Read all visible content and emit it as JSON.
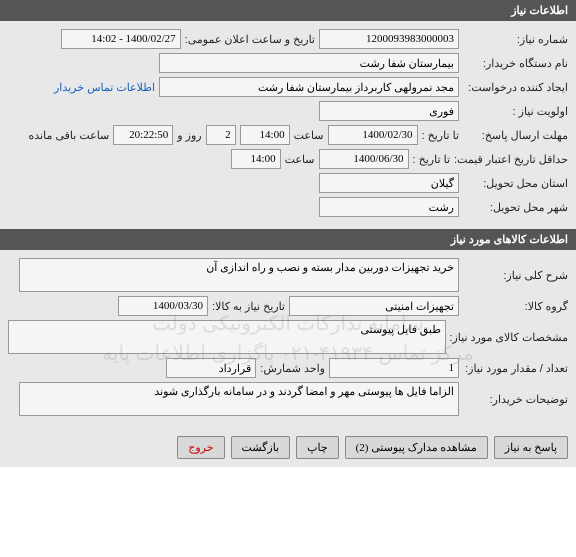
{
  "section1": {
    "title": "اطلاعات نیاز",
    "req_no_label": "شماره نیاز:",
    "req_no": "1200093983000003",
    "announce_label": "تاریخ و ساعت اعلان عمومی:",
    "announce": "1400/02/27 - 14:02",
    "buyer_label": "نام دستگاه خریدار:",
    "buyer": "بیمارستان شفا رشت",
    "creator_label": "ایجاد کننده درخواست:",
    "creator": "مجد نمرولهی کاربرداز بیمارستان شفا رشت",
    "contact_link": "اطلاعات تماس خریدار",
    "priority_label": "اولویت نیاز :",
    "priority": "فوری",
    "deadline_label": "مهلت ارسال پاسخ:",
    "deadline_to_label": "تا تاریخ :",
    "deadline_date": "1400/02/30",
    "time_label": "ساعت",
    "deadline_time": "14:00",
    "days": "2",
    "days_label": "روز و",
    "remain": "20:22:50",
    "remain_label": "ساعت باقی مانده",
    "min_credit_label": "حداقل تاریخ اعتبار قیمت:",
    "min_credit_to_label": "تا تاریخ :",
    "min_credit_date": "1400/06/30",
    "min_credit_time": "14:00",
    "province_label": "استان محل تحویل:",
    "province": "گیلان",
    "city_label": "شهر محل تحویل:",
    "city": "رشت"
  },
  "section2": {
    "title": "اطلاعات کالاهای مورد نیاز",
    "desc_label": "شرح کلی نیاز:",
    "desc": "خرید تجهیزات دوربین مدار بسته و نصب و راه اندازی آن",
    "group_label": "گروه کالا:",
    "group": "تجهیزات امنیتی",
    "need_date_label": "تاریخ نیاز به کالا:",
    "need_date": "1400/03/30",
    "spec_label": "مشخصات کالای مورد نیاز:",
    "spec": "طبق فایل پیوستی",
    "qty_label": "تعداد / مقدار مورد نیاز:",
    "qty": "1",
    "unit_label": "واحد شمارش:",
    "unit": "قرارداد",
    "notes_label": "توضیحات خریدار:",
    "notes": "الزاما فایل ها پیوستی مهر و امضا گردند و در سامانه بارگذاری شوند",
    "watermark1": "سامانه تدارکات الکترونیکی دولت",
    "watermark2": "مرکز تماس ۴۱۹۳۴-۰۲۱   باگزاری اطلاعات پایه"
  },
  "buttons": {
    "reply": "پاسخ به نیاز",
    "attach": "مشاهده مدارک پیوستی (2)",
    "print": "چاپ",
    "back": "بازگشت",
    "exit": "خروج"
  }
}
